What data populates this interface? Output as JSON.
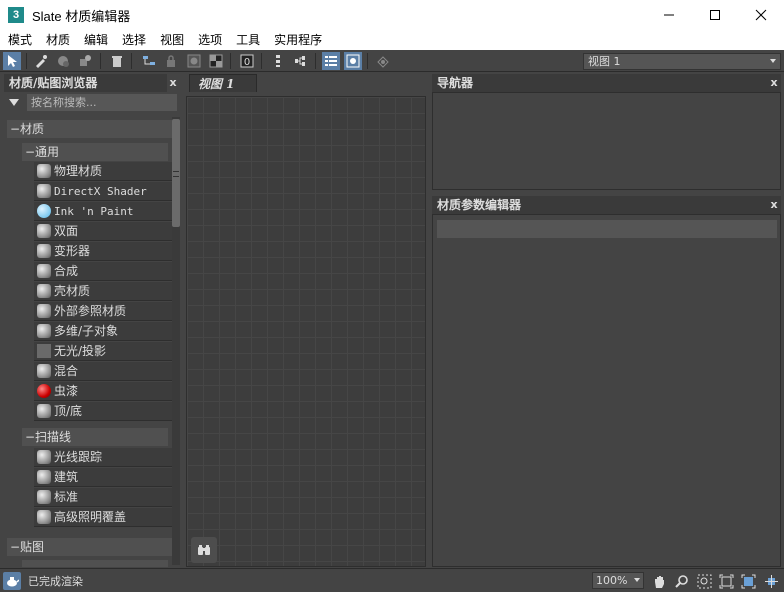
{
  "window": {
    "app_icon": "3",
    "title": "Slate 材质编辑器"
  },
  "menu": [
    "模式",
    "材质",
    "编辑",
    "选择",
    "视图",
    "选项",
    "工具",
    "实用程序"
  ],
  "toolbar": {
    "view_select": "视图 1",
    "active_tool": "select-arrow"
  },
  "browser": {
    "title": "材质/贴图浏览器",
    "search_placeholder": "按名称搜索...",
    "materials_group": "材质",
    "general_group": "通用",
    "general_items": [
      "物理材质",
      "DirectX Shader",
      "Ink 'n Paint",
      "双面",
      "变形器",
      "合成",
      "壳材质",
      "外部参照材质",
      "多维/子对象",
      "无光/投影",
      "混合",
      "虫漆",
      "顶/底"
    ],
    "scanline_group": "扫描线",
    "scanline_items": [
      "光线跟踪",
      "建筑",
      "标准",
      "高级照明覆盖"
    ],
    "maps_group": "贴图"
  },
  "viewport": {
    "tab_label": "视图 1"
  },
  "navigator": {
    "title": "导航器"
  },
  "param_editor": {
    "title": "材质参数编辑器"
  },
  "status": {
    "text": "已完成渲染",
    "zoom": "100%"
  },
  "colors": {
    "accent": "#5b7fa6",
    "panel_bg": "#444444",
    "header_bg": "#3a3a3a",
    "shellac_red": "#cc0000",
    "ink_paint_blue": "#7cc8ee"
  }
}
